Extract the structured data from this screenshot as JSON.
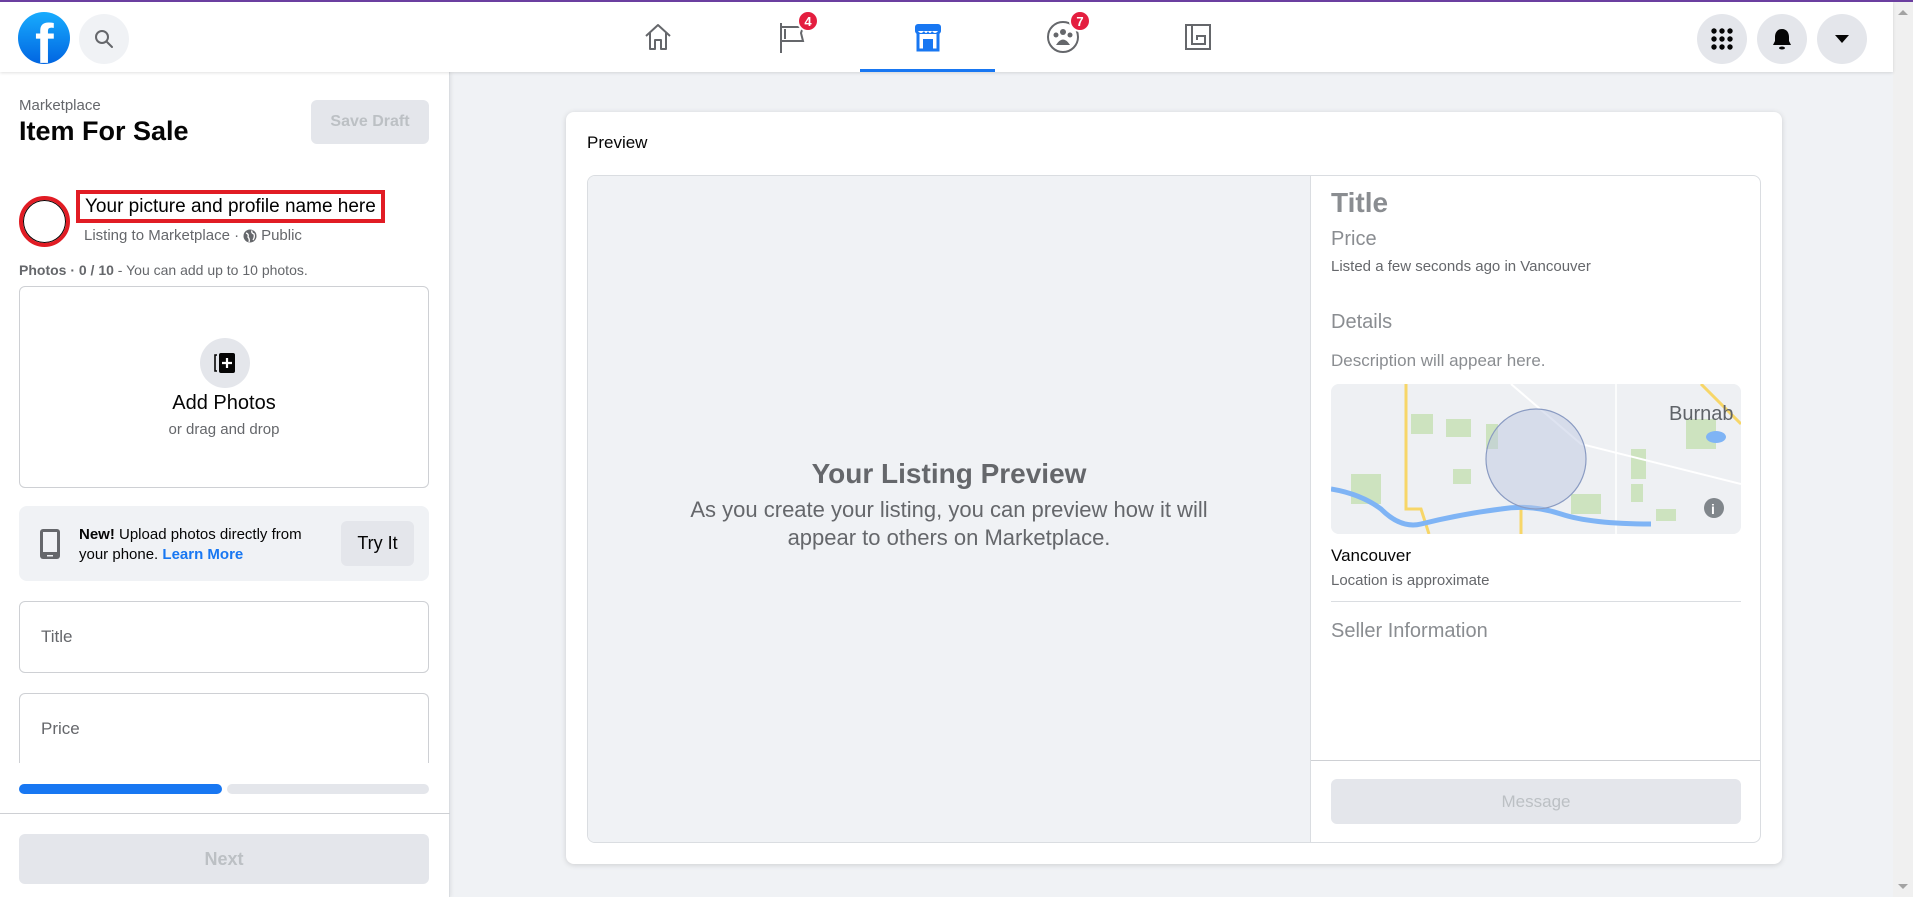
{
  "header": {
    "logo": "facebook-logo",
    "logo_glyph": "f",
    "search_icon": "search-icon",
    "nav_tabs": [
      {
        "name": "home",
        "icon": "home-icon",
        "badge": null,
        "active": false
      },
      {
        "name": "pages",
        "icon": "flag-icon",
        "badge": "4",
        "active": false
      },
      {
        "name": "marketplace",
        "icon": "marketplace-icon",
        "badge": null,
        "active": true
      },
      {
        "name": "groups",
        "icon": "groups-icon",
        "badge": "7",
        "active": false
      },
      {
        "name": "gaming",
        "icon": "gaming-icon",
        "badge": null,
        "active": false
      }
    ],
    "right_buttons": [
      "menu-grid-icon",
      "notifications-bell-icon",
      "account-dropdown-icon"
    ]
  },
  "sidebar": {
    "breadcrumb": "Marketplace",
    "title": "Item For Sale",
    "save_draft_label": "Save Draft",
    "profile_name": "Your picture and profile name here",
    "listing_to": "Listing to Marketplace · ",
    "audience": "Public",
    "photos_label_bold": "Photos · 0 / 10",
    "photos_label_rest": " - You can add up to 10 photos.",
    "add_photos_label": "Add Photos",
    "drag_label": "or drag and drop",
    "banner": {
      "new_label": "New!",
      "text": " Upload photos directly from your phone. ",
      "learn_more": "Learn More",
      "try_it_label": "Try It"
    },
    "title_placeholder": "Title",
    "price_placeholder": "Price",
    "progress": {
      "steps_total": 2,
      "steps_completed": 1
    },
    "next_label": "Next"
  },
  "preview": {
    "label": "Preview",
    "placeholder_title": "Your Listing Preview",
    "placeholder_desc": "As you create your listing, you can preview how it will appear to others on Marketplace.",
    "item_title": "Title",
    "item_price": "Price",
    "listed_text": "Listed a few seconds ago in Vancouver",
    "details_heading": "Details",
    "description_placeholder": "Description will appear here.",
    "map_label": "Burnab",
    "city": "Vancouver",
    "location_note": "Location is approximate",
    "seller_heading": "Seller Information",
    "message_label": "Message"
  },
  "colors": {
    "accent": "#1877f2",
    "badge": "#e41e3f",
    "annotation_red": "#e11c24"
  }
}
